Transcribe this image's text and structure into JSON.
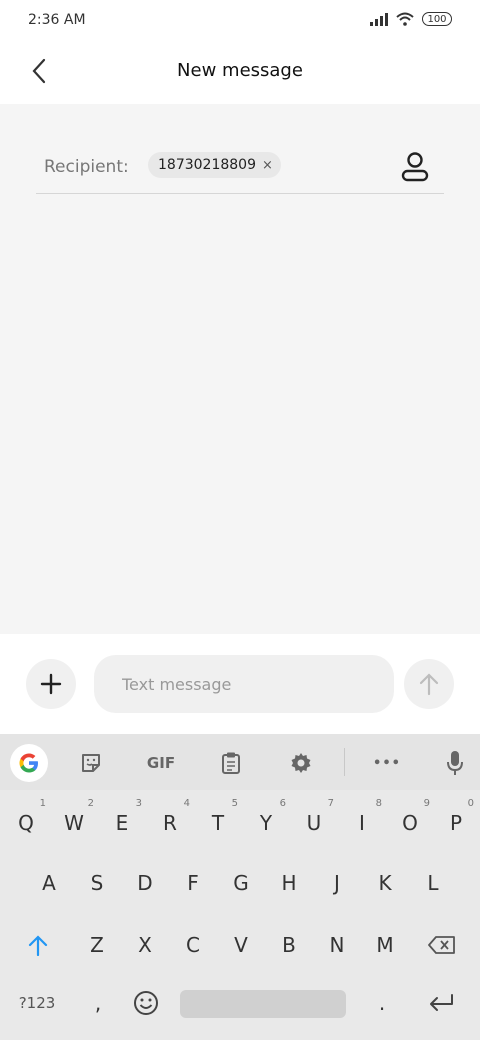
{
  "status_bar": {
    "time": "2:36 AM",
    "battery": "100"
  },
  "header": {
    "title": "New message"
  },
  "recipient": {
    "label": "Recipient:",
    "chip_number": "18730218809",
    "chip_close": "×"
  },
  "compose": {
    "placeholder": "Text message"
  },
  "keyboard": {
    "toolbar": {
      "gif_label": "GIF",
      "more_label": "•••"
    },
    "row1": [
      {
        "key": "Q",
        "hint": "1"
      },
      {
        "key": "W",
        "hint": "2"
      },
      {
        "key": "E",
        "hint": "3"
      },
      {
        "key": "R",
        "hint": "4"
      },
      {
        "key": "T",
        "hint": "5"
      },
      {
        "key": "Y",
        "hint": "6"
      },
      {
        "key": "U",
        "hint": "7"
      },
      {
        "key": "I",
        "hint": "8"
      },
      {
        "key": "O",
        "hint": "9"
      },
      {
        "key": "P",
        "hint": "0"
      }
    ],
    "row2": [
      "A",
      "S",
      "D",
      "F",
      "G",
      "H",
      "J",
      "K",
      "L"
    ],
    "row3": [
      "Z",
      "X",
      "C",
      "V",
      "B",
      "N",
      "M"
    ],
    "row4": {
      "symbols_label": "?123",
      "comma_label": ",",
      "period_label": "."
    }
  }
}
